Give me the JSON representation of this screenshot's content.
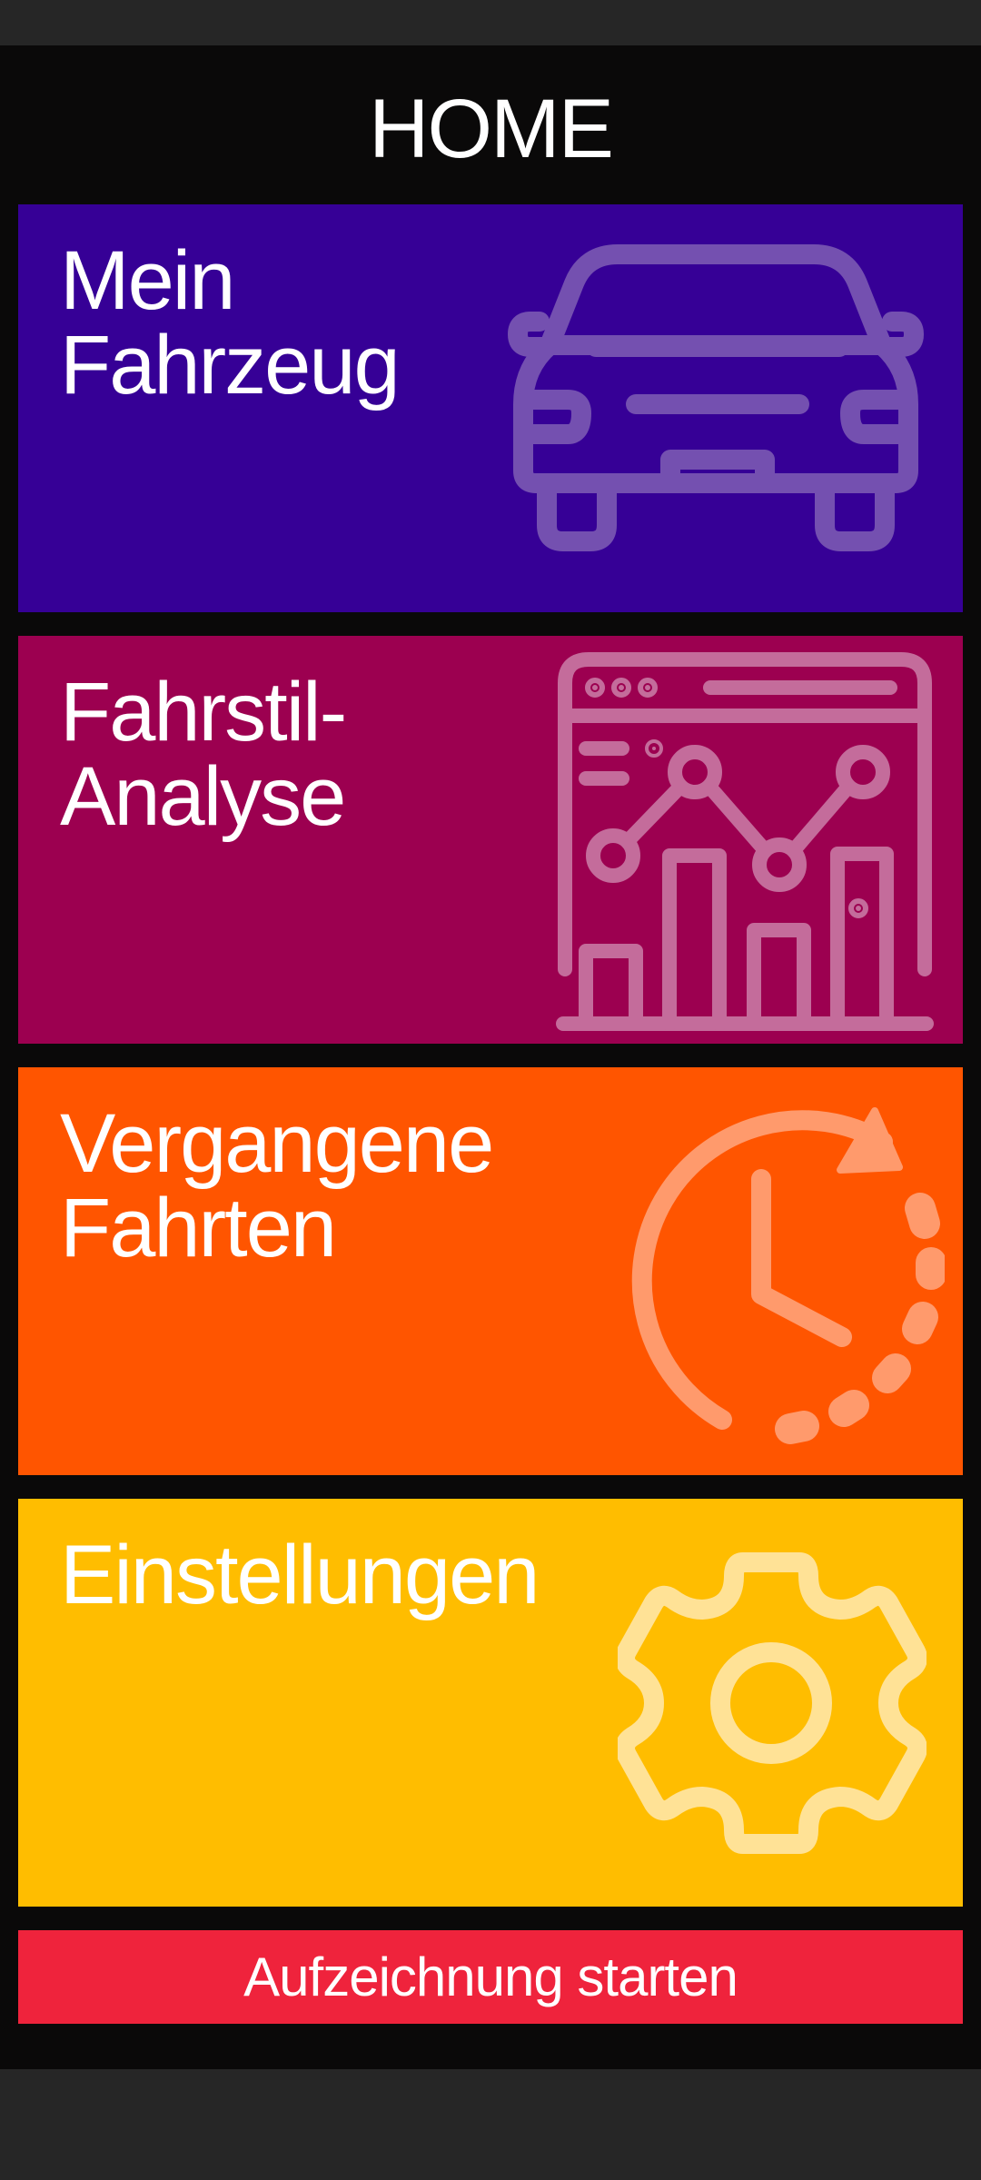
{
  "header": {
    "title": "HOME"
  },
  "colors": {
    "background": "#0a0909",
    "system_bars": "#262626",
    "vehicle_tile": "#360096",
    "analysis_tile": "#9c0050",
    "trips_tile": "#ff5500",
    "settings_tile": "#ffbd00",
    "record_button": "#ef233c"
  },
  "tiles": [
    {
      "label": "Mein\nFahrzeug",
      "icon": "car-icon"
    },
    {
      "label": "Fahrstil-\nAnalyse",
      "icon": "analytics-chart-icon"
    },
    {
      "label": "Vergangene\nFahrten",
      "icon": "history-clock-icon"
    },
    {
      "label": "Einstellungen",
      "icon": "gear-icon"
    }
  ],
  "record_button": {
    "label": "Aufzeichnung starten"
  }
}
